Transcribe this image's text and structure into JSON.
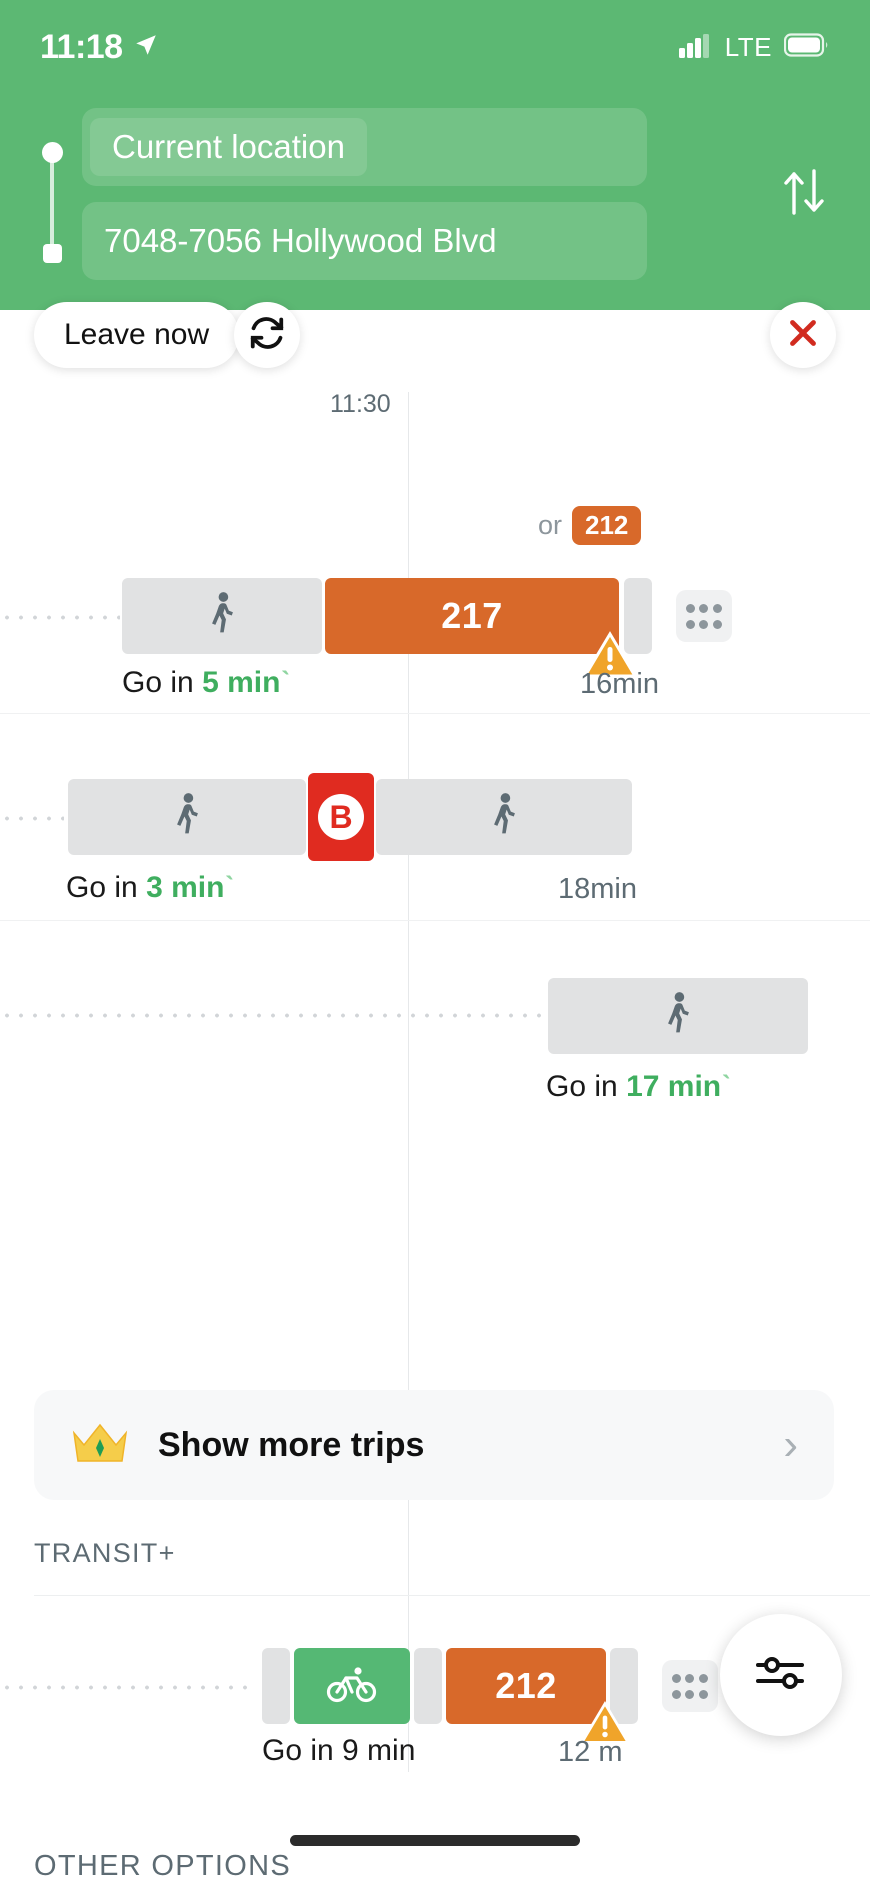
{
  "status_bar": {
    "time": "11:18",
    "location_icon": "location-arrow-icon",
    "signal_icon": "cellular-signal-icon",
    "carrier": "LTE",
    "battery_icon": "battery-icon"
  },
  "route": {
    "origin": "Current location",
    "destination": "7048-7056 Hollywood Blvd",
    "swap_icon": "swap-vertical-icon",
    "start_dot_name": "origin-dot",
    "end_dot_name": "destination-square"
  },
  "controls": {
    "leave_now": "Leave now",
    "refresh_icon": "refresh-icon",
    "close_icon": "close-x-icon"
  },
  "timeline": {
    "axis_time": "11:30"
  },
  "trips": [
    {
      "id": "trip-1",
      "or_prefix": "or",
      "or_route": "212",
      "go_prefix": "Go in",
      "go_minutes": "5 min",
      "live_tick": "ˋ",
      "duration": "16min",
      "has_alert": true,
      "alert_icon": "warning-triangle-icon",
      "more_icon": "grid-dots-icon",
      "segments": [
        {
          "type": "walk",
          "icon": "walking-person-icon",
          "label": ""
        },
        {
          "type": "bus",
          "icon": "bus-route-number",
          "label": "217"
        },
        {
          "type": "gap",
          "icon": "",
          "label": ""
        }
      ]
    },
    {
      "id": "trip-2",
      "go_prefix": "Go in",
      "go_minutes": "3 min",
      "live_tick": "ˋ",
      "duration": "18min",
      "has_alert": false,
      "segments": [
        {
          "type": "walk",
          "icon": "walking-person-icon",
          "label": ""
        },
        {
          "type": "metro",
          "icon": "metro-line-badge",
          "label": "B"
        },
        {
          "type": "walk",
          "icon": "walking-person-icon",
          "label": ""
        }
      ]
    },
    {
      "id": "trip-3",
      "go_prefix": "Go in",
      "go_minutes": "17 min",
      "live_tick": "ˋ",
      "duration": "",
      "has_alert": false,
      "segments": [
        {
          "type": "walk",
          "icon": "walking-person-icon",
          "label": ""
        }
      ]
    }
  ],
  "show_more": {
    "crown_icon": "crown-icon",
    "label": "Show more trips",
    "chevron_icon": "chevron-right-icon"
  },
  "sections": {
    "transit_plus": "TRANSIT+",
    "other_options": "OTHER OPTIONS"
  },
  "transit_plus_trip": {
    "id": "trip-bike",
    "go_label": "Go in 9 min",
    "duration": "12 m",
    "route_number": "212",
    "bike_icon": "bicycle-icon",
    "alert_icon": "warning-triangle-icon",
    "more_icon": "grid-dots-icon"
  },
  "fab": {
    "icon": "filter-sliders-icon"
  },
  "colors": {
    "header_green": "#5cb873",
    "bus_orange": "#d8692a",
    "metro_red": "#e02b20",
    "bike_green": "#55b874",
    "go_green": "#3fae5f",
    "warn_amber": "#f0a42a",
    "segment_grey": "#e1e2e3"
  }
}
